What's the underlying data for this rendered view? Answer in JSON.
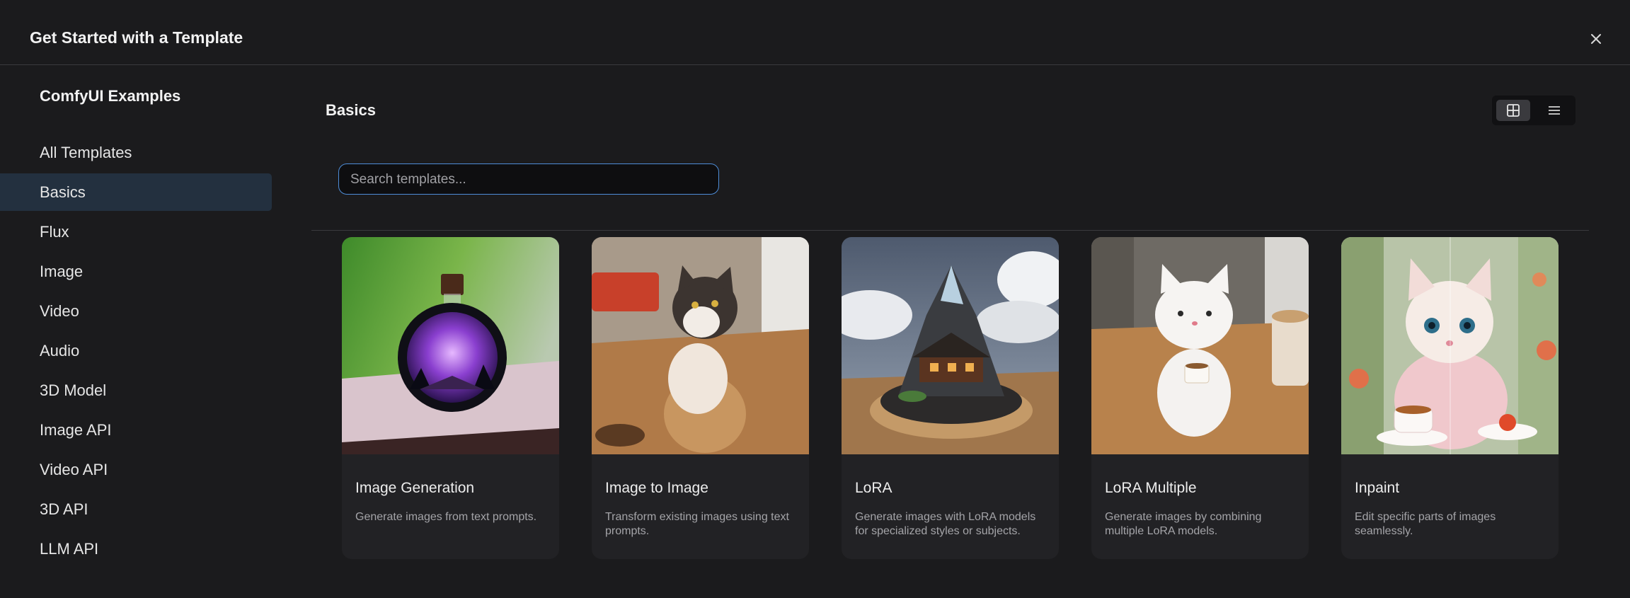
{
  "dialog": {
    "title": "Get Started with a Template"
  },
  "sidebar": {
    "heading": "ComfyUI Examples",
    "items": [
      {
        "label": "All Templates",
        "active": false
      },
      {
        "label": "Basics",
        "active": true
      },
      {
        "label": "Flux",
        "active": false
      },
      {
        "label": "Image",
        "active": false
      },
      {
        "label": "Video",
        "active": false
      },
      {
        "label": "Audio",
        "active": false
      },
      {
        "label": "3D Model",
        "active": false
      },
      {
        "label": "Image API",
        "active": false
      },
      {
        "label": "Video API",
        "active": false
      },
      {
        "label": "3D API",
        "active": false
      },
      {
        "label": "LLM API",
        "active": false
      }
    ]
  },
  "main": {
    "section_title": "Basics",
    "view_mode": "grid",
    "search": {
      "placeholder": "Search templates...",
      "value": ""
    },
    "cards": [
      {
        "title": "Image Generation",
        "description": "Generate images from text prompts.",
        "thumbnail": "purple-galaxy-in-bottle"
      },
      {
        "title": "Image to Image",
        "description": "Transform existing images using text prompts.",
        "thumbnail": "tabby-cat-sitting"
      },
      {
        "title": "LoRA",
        "description": "Generate images with LoRA models for specialized styles or subjects.",
        "thumbnail": "miniature-mountain-cabin"
      },
      {
        "title": "LoRA Multiple",
        "description": "Generate images by combining multiple LoRA models.",
        "thumbnail": "white-cat-figurine-with-cup"
      },
      {
        "title": "Inpaint",
        "description": "Edit specific parts of images seamlessly.",
        "thumbnail": "kitten-with-tea-cup"
      }
    ]
  },
  "colors": {
    "background": "#1b1b1d",
    "active_nav": "#23303f",
    "search_focus_border": "#4e8dd8",
    "card_background": "#222225"
  }
}
